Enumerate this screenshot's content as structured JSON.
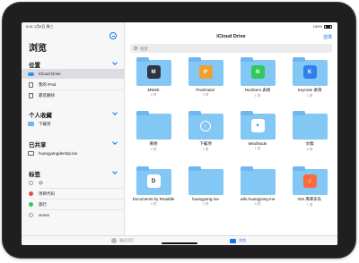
{
  "status": {
    "time": "9:41",
    "date": "1月9日 周三",
    "battery": "100%"
  },
  "sidebar": {
    "title": "浏览",
    "sections": {
      "locations": "位置",
      "favorites": "个人收藏",
      "shared": "已共享",
      "tags": "标签"
    },
    "locations": [
      {
        "label": "iCloud Drive",
        "icon": "icloud-icon"
      },
      {
        "label": "我的 iPad",
        "icon": "ipad-icon"
      },
      {
        "label": "最近删除",
        "icon": "trash-icon"
      }
    ],
    "favorites": [
      {
        "label": "下载项",
        "icon": "folder-icon"
      }
    ],
    "shared": [
      {
        "label": "huangyangdembp.lan",
        "icon": "server-icon"
      }
    ],
    "tags": [
      {
        "label": "😃",
        "color": "#ffffff"
      },
      {
        "label": "项目代码",
        "color": "#e64b3b"
      },
      {
        "label": "旅行",
        "color": "#34c759"
      },
      {
        "label": "Home",
        "color": "#ffffff"
      }
    ]
  },
  "main": {
    "title": "iCloud Drive",
    "select_label": "选择",
    "search_placeholder": "搜索",
    "files": [
      {
        "name": "MWeb",
        "meta": "2 项",
        "badge": "M",
        "badge_color": "#2e3440"
      },
      {
        "name": "Pixelmator",
        "meta": "0 项",
        "badge": "P",
        "badge_color": "#f0a030"
      },
      {
        "name": "Numbers 表格",
        "meta": "1 项",
        "badge": "N",
        "badge_color": "#34c759"
      },
      {
        "name": "Keynote 讲演",
        "meta": "1 项",
        "badge": "K",
        "badge_color": "#2f80ed"
      },
      {
        "name": "黄杨",
        "meta": "4 项",
        "badge": "",
        "badge_color": ""
      },
      {
        "name": "下载项",
        "meta": "2 项",
        "badge": "download",
        "badge_color": ""
      },
      {
        "name": "MindNode",
        "meta": "1 项",
        "badge": "✦",
        "badge_color": "#ffffff"
      },
      {
        "name": "文稿",
        "meta": "6 项",
        "badge": "",
        "badge_color": ""
      },
      {
        "name": "Documents by Readdle",
        "meta": "0 项",
        "badge": "D",
        "badge_color": "#ffffff"
      },
      {
        "name": "huangyang.me",
        "meta": "3 项",
        "badge": "",
        "badge_color": ""
      },
      {
        "name": "wiki.huangyang.me",
        "meta": "5 项",
        "badge": "",
        "badge_color": ""
      },
      {
        "name": "iOS 库库乐队",
        "meta": "1 项",
        "badge": "♫",
        "badge_color": "#ff6a3d"
      }
    ]
  },
  "toolbar": {
    "recents": "最近项目",
    "browse": "浏览"
  }
}
